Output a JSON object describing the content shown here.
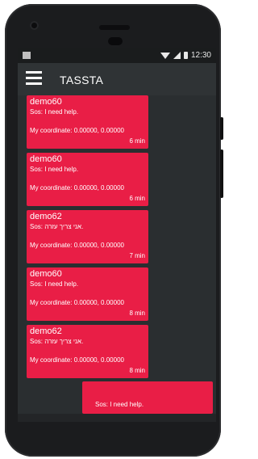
{
  "statusbar": {
    "time": "12:30"
  },
  "appbar": {
    "title": "TASSTA"
  },
  "messages": [
    {
      "sender": "demo60",
      "text": "Sos: I need help.",
      "coordinate": "My coordinate:  0.00000, 0.00000",
      "age": "6 min"
    },
    {
      "sender": "demo60",
      "text": "Sos: I need help.",
      "coordinate": "My coordinate:  0.00000, 0.00000",
      "age": "6 min"
    },
    {
      "sender": "demo62",
      "text": "Sos: אני צריך עזרה.",
      "coordinate": "My coordinate:  0.00000, 0.00000",
      "age": "7 min"
    },
    {
      "sender": "demo60",
      "text": "Sos: I need help.",
      "coordinate": "My coordinate:  0.00000, 0.00000",
      "age": "8 min"
    },
    {
      "sender": "demo62",
      "text": "Sos: אני צריך עזרה.",
      "coordinate": "My coordinate:  0.00000, 0.00000",
      "age": "8 min"
    }
  ],
  "outgoing": {
    "text": "Sos: I need help."
  },
  "colors": {
    "alert": "#e91e46",
    "background": "#2a2e30",
    "appbar": "#2f3335"
  }
}
